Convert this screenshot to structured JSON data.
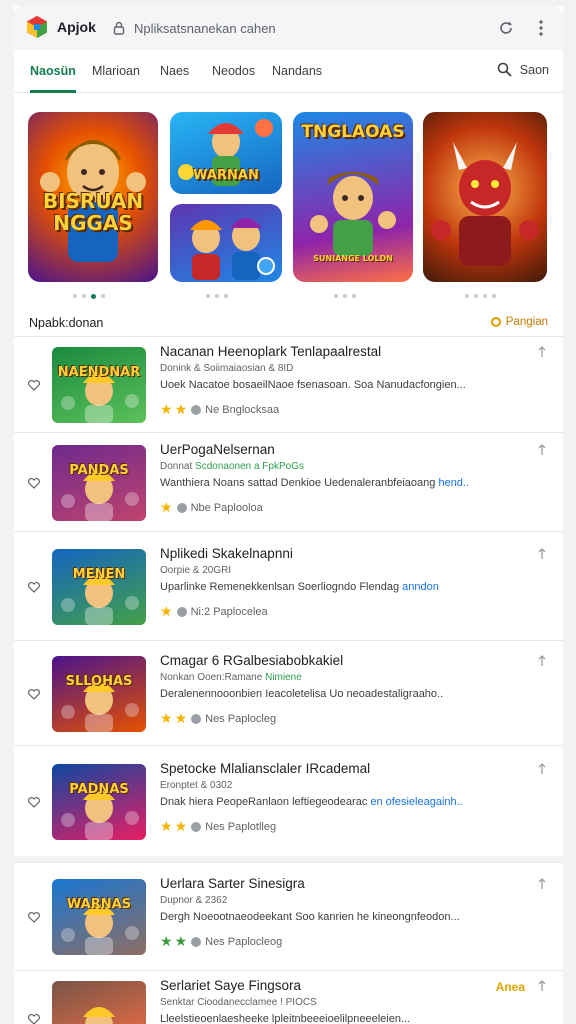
{
  "header": {
    "app_name": "Apjok",
    "search_placeholder": "Npliksatsnanekan cahen",
    "logo_colors": [
      "#e53935",
      "#43a047",
      "#fbc02d",
      "#1e88e5"
    ]
  },
  "tabs": [
    {
      "label": "Naosün",
      "active": true
    },
    {
      "label": "Mlarioan",
      "active": false
    },
    {
      "label": "Naes",
      "active": false
    },
    {
      "label": "Neodos",
      "active": false
    },
    {
      "label": "Nandans",
      "active": false
    }
  ],
  "tab_search_label": "Saon",
  "banners": [
    {
      "title": "BISRUAN NGGAS",
      "icon": "hero-knight-art"
    },
    {
      "title": "WARNAN",
      "icon": "hero-elf-art"
    },
    {
      "title": "",
      "icon": "hero-duo-art"
    },
    {
      "title": "TNGLAOAS",
      "icon": "hero-pirate-art",
      "subtitle": "SUNIANGE LOLDN"
    },
    {
      "title": "",
      "icon": "hero-demon-art"
    }
  ],
  "section": {
    "title": "Npabk:donan",
    "link_label": "Pangian"
  },
  "apps": [
    {
      "title": "Nacanan Heenoplark Tenlapaalrestal",
      "meta": "Donink  & Soiimaiaosian  & 8ID",
      "meta_accent": "",
      "desc": "Uoek Nacatoe bosaeilNaoe fsenasoan. Soa Nanudacfongien...",
      "desc_accent": "",
      "stars": 2,
      "star_color": "#f5b400",
      "rating": "Ne",
      "tag": "Bnglocksaa",
      "thumb_text": "NAENDNAR",
      "thumb_colors": [
        "#1b8a3f",
        "#5cc15a"
      ]
    },
    {
      "title": "UerPogaNelsernan",
      "meta": "Donnat",
      "meta_accent": "Scdonaonen a  FpkPoGs",
      "desc": "Wanthiera Noans sattad Denkioe Uedenaleranbfeiaoang",
      "desc_accent": "hend..",
      "stars": 1,
      "star_color": "#f5b400",
      "rating": "Nbe",
      "tag": "Paplooloa",
      "thumb_text": "PANDAS",
      "thumb_colors": [
        "#6d2a8e",
        "#c0436d"
      ]
    },
    {
      "title": "Nplikedi Skakelnapnni",
      "meta": "Oorpie  & 20GRI",
      "meta_accent": "",
      "desc": "Uparlinke Remenekkenlsan Soerliogndo Flendag",
      "desc_accent": "anndon",
      "stars": 1,
      "star_color": "#f5b400",
      "rating": "Ni:2",
      "tag": "Paplocelea",
      "thumb_text": "MENEN",
      "thumb_colors": [
        "#1565c0",
        "#43a047"
      ]
    },
    {
      "title": "Cmagar 6 RGalbesiabobkakiel",
      "meta": "Nonkan  Ooen:Ramane",
      "meta_accent": "Nimiene",
      "desc": "Deralenennooonbien Ieacoletelisa Uo neoadestaligraaho..",
      "desc_accent": "",
      "stars": 2,
      "star_color": "#f5b400",
      "rating": "Nes",
      "tag": "Paplocleg",
      "thumb_text": "SLLOHAS",
      "thumb_colors": [
        "#4a148c",
        "#e65100"
      ]
    },
    {
      "title": "Spetocke Mlaliansclaler IRcademal",
      "meta": "Eronptet  & 0302",
      "meta_accent": "",
      "desc": "Dnak hiera PeopeRanlaon leftiegeodearac",
      "desc_accent": "en ofesieleagainh..",
      "stars": 2,
      "star_color": "#f5b400",
      "rating": "Nes",
      "tag": "Paplotlleg",
      "thumb_text": "PADNAS",
      "thumb_colors": [
        "#0d47a1",
        "#e91e63"
      ]
    },
    {
      "title": "Uerlara Sarter Sinesigra",
      "meta": "Dupnor  & 2362",
      "meta_accent": "",
      "desc": "Dergh Noeootnaeodeekant Soo kanrien he kineongnfeodon...",
      "desc_accent": "",
      "stars": 2,
      "star_color": "#3a9a3c",
      "rating": "Nes",
      "tag": "Paplocleog",
      "thumb_text": "WARNAS",
      "thumb_colors": [
        "#1976d2",
        "#8d6e63"
      ]
    },
    {
      "title": "Serlariet Saye Fingsora",
      "meta": "Senktar  Cioodanecclamee  ! PIOCS",
      "meta_accent": "",
      "desc": "Lleelstieoenlaesheeke lpleitnbeeeioelilpneeeleien...",
      "desc_accent": "",
      "stars": 0,
      "star_color": "#f5b400",
      "rating": "",
      "tag": "",
      "thumb_text": "",
      "thumb_colors": [
        "#795548",
        "#ff7043"
      ],
      "side_tag": "Anea"
    }
  ]
}
